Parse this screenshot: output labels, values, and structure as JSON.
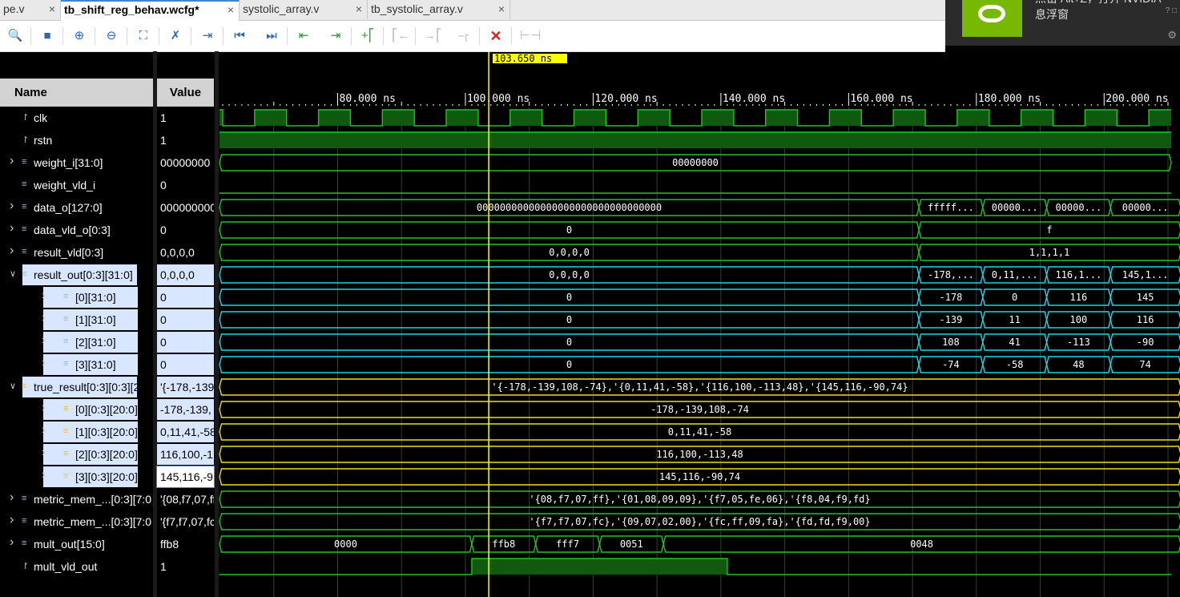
{
  "tabs": [
    {
      "label": "pe.v"
    },
    {
      "label": "tb_shift_reg_behav.wcfg*",
      "active": true
    },
    {
      "label": "systolic_array.v"
    },
    {
      "label": "tb_systolic_array.v"
    }
  ],
  "notification": {
    "line1": "点击 Alt+Z，打开 NVIDIA",
    "line2": "息浮窗"
  },
  "toolbar": {
    "icons": [
      "zoom-search",
      "save",
      "zoom-in",
      "zoom-out",
      "zoom-fit",
      "auto-scroll",
      "goto-cursor",
      "goto-start",
      "goto-end",
      "prev-transition",
      "next-transition",
      "add-marker",
      "prev-marker",
      "next-marker",
      "swap-cursors",
      "delete",
      "snap"
    ]
  },
  "header": {
    "name": "Name",
    "value": "Value"
  },
  "cursor": {
    "label": "103.650 ns",
    "time_ns": 103.65
  },
  "timeline": {
    "start_ns": 61.5,
    "end_ns": 210.5,
    "ticks": [
      "80.000 ns",
      "100.000 ns",
      "120.000 ns",
      "140.000 ns",
      "160.000 ns",
      "180.000 ns",
      "200.000 ns"
    ],
    "tick_ns": [
      80,
      100,
      120,
      140,
      160,
      180,
      200
    ]
  },
  "signals": [
    {
      "name": "clk",
      "value": "1",
      "indent": 0,
      "icon": "bit",
      "expand": false
    },
    {
      "name": "rstn",
      "value": "1",
      "indent": 0,
      "icon": "bit",
      "expand": false
    },
    {
      "name": "weight_i[31:0]",
      "value": "00000000",
      "indent": 0,
      "icon": "bus",
      "expand": "collapsed"
    },
    {
      "name": "weight_vld_i",
      "value": "0",
      "indent": 0,
      "icon": "bus",
      "expand": false
    },
    {
      "name": "data_o[127:0]",
      "value": "000000000",
      "indent": 0,
      "icon": "bus",
      "expand": "collapsed"
    },
    {
      "name": "data_vld_o[0:3]",
      "value": "0",
      "indent": 0,
      "icon": "bus",
      "expand": "collapsed"
    },
    {
      "name": "result_vld[0:3]",
      "value": "0,0,0,0",
      "indent": 0,
      "icon": "bus",
      "expand": "collapsed"
    },
    {
      "name": "result_out[0:3][31:0]",
      "value": "0,0,0,0",
      "indent": 0,
      "icon": "array",
      "expand": "expanded",
      "hl": true
    },
    {
      "name": "[0][31:0]",
      "value": "0",
      "indent": 1,
      "icon": "array",
      "expand": "collapsed",
      "hl": true
    },
    {
      "name": "[1][31:0]",
      "value": "0",
      "indent": 1,
      "icon": "array",
      "expand": "collapsed",
      "hl": true
    },
    {
      "name": "[2][31:0]",
      "value": "0",
      "indent": 1,
      "icon": "array",
      "expand": "collapsed",
      "hl": true
    },
    {
      "name": "[3][31:0]",
      "value": "0",
      "indent": 1,
      "icon": "array",
      "expand": "collapsed",
      "hl": true
    },
    {
      "name": "true_result[0:3][0:3][20:",
      "value": "'{-178,-139",
      "indent": 0,
      "icon": "const",
      "expand": "expanded",
      "hl": true
    },
    {
      "name": "[0][0:3][20:0]",
      "value": "-178,-139,",
      "indent": 1,
      "icon": "const",
      "expand": "collapsed",
      "hl": true
    },
    {
      "name": "[1][0:3][20:0]",
      "value": "0,11,41,-58",
      "indent": 1,
      "icon": "const",
      "expand": "collapsed",
      "hl": true
    },
    {
      "name": "[2][0:3][20:0]",
      "value": "116,100,-1",
      "indent": 1,
      "icon": "const",
      "expand": "collapsed",
      "hl": true
    },
    {
      "name": "[3][0:3][20:0]",
      "value": "145,116,-9",
      "indent": 1,
      "icon": "const",
      "expand": "collapsed",
      "hl": true,
      "boxed": true
    },
    {
      "name": "metric_mem_...[0:3][7:0",
      "value": "'{08,f7,07,ff",
      "indent": 0,
      "icon": "bus",
      "expand": "collapsed"
    },
    {
      "name": "metric_mem_...[0:3][7:0",
      "value": "'{f7,f7,07,fc",
      "indent": 0,
      "icon": "bus",
      "expand": "collapsed"
    },
    {
      "name": "mult_out[15:0]",
      "value": "ffb8",
      "indent": 0,
      "icon": "bus",
      "expand": "collapsed"
    },
    {
      "name": "mult_vld_out",
      "value": "1",
      "indent": 0,
      "icon": "bit",
      "expand": false
    }
  ],
  "waves": [
    {
      "kind": "clock",
      "color": "#22c322",
      "start_ns": 61.5,
      "first_edge_ns": 62,
      "period_ns": 10,
      "start_level": 1
    },
    {
      "kind": "bit",
      "color": "#22c322",
      "segments": [
        [
          61.5,
          210.5,
          1
        ]
      ]
    },
    {
      "kind": "bus",
      "color": "#22c322",
      "segments": [
        [
          61.5,
          210.5,
          "00000000"
        ]
      ]
    },
    {
      "kind": "bit",
      "color": "#22c322",
      "segments": [
        [
          61.5,
          210.5,
          0
        ]
      ]
    },
    {
      "kind": "bus",
      "color": "#22c322",
      "segments": [
        [
          61.5,
          171,
          "00000000000000000000000000000000"
        ],
        [
          171,
          181,
          "fffff..."
        ],
        [
          181,
          191,
          "00000..."
        ],
        [
          191,
          201,
          "00000..."
        ],
        [
          201,
          212,
          "00000..."
        ]
      ]
    },
    {
      "kind": "bus",
      "color": "#22c322",
      "segments": [
        [
          61.5,
          171,
          "0"
        ],
        [
          171,
          212,
          "f"
        ]
      ]
    },
    {
      "kind": "bus",
      "color": "#22c322",
      "segments": [
        [
          61.5,
          171,
          "0,0,0,0"
        ],
        [
          171,
          212,
          "1,1,1,1"
        ]
      ]
    },
    {
      "kind": "bus",
      "color": "#19d9e6",
      "segments": [
        [
          61.5,
          171,
          "0,0,0,0"
        ],
        [
          171,
          181,
          "-178,..."
        ],
        [
          181,
          191,
          "0,11,..."
        ],
        [
          191,
          201,
          "116,1..."
        ],
        [
          201,
          212,
          "145,1..."
        ]
      ]
    },
    {
      "kind": "bus",
      "color": "#19d9e6",
      "segments": [
        [
          61.5,
          171,
          "0"
        ],
        [
          171,
          181,
          "-178"
        ],
        [
          181,
          191,
          "0"
        ],
        [
          191,
          201,
          "116"
        ],
        [
          201,
          212,
          "145"
        ]
      ]
    },
    {
      "kind": "bus",
      "color": "#19d9e6",
      "segments": [
        [
          61.5,
          171,
          "0"
        ],
        [
          171,
          181,
          "-139"
        ],
        [
          181,
          191,
          "11"
        ],
        [
          191,
          201,
          "100"
        ],
        [
          201,
          212,
          "116"
        ]
      ]
    },
    {
      "kind": "bus",
      "color": "#19d9e6",
      "segments": [
        [
          61.5,
          171,
          "0"
        ],
        [
          171,
          181,
          "108"
        ],
        [
          181,
          191,
          "41"
        ],
        [
          191,
          201,
          "-113"
        ],
        [
          201,
          212,
          "-90"
        ]
      ]
    },
    {
      "kind": "bus",
      "color": "#19d9e6",
      "segments": [
        [
          61.5,
          171,
          "0"
        ],
        [
          171,
          181,
          "-74"
        ],
        [
          181,
          191,
          "-58"
        ],
        [
          191,
          201,
          "48"
        ],
        [
          201,
          212,
          "74"
        ]
      ]
    },
    {
      "kind": "bus",
      "color": "#e8e01e",
      "segments": [
        [
          61.5,
          212,
          "'{-178,-139,108,-74},'{0,11,41,-58},'{116,100,-113,48},'{145,116,-90,74}"
        ]
      ]
    },
    {
      "kind": "bus",
      "color": "#e8e01e",
      "segments": [
        [
          61.5,
          212,
          "-178,-139,108,-74"
        ]
      ]
    },
    {
      "kind": "bus",
      "color": "#e8e01e",
      "segments": [
        [
          61.5,
          212,
          "0,11,41,-58"
        ]
      ]
    },
    {
      "kind": "bus",
      "color": "#e8e01e",
      "segments": [
        [
          61.5,
          212,
          "116,100,-113,48"
        ]
      ]
    },
    {
      "kind": "bus",
      "color": "#e8e01e",
      "segments": [
        [
          61.5,
          212,
          "145,116,-90,74"
        ]
      ]
    },
    {
      "kind": "bus",
      "color": "#22c322",
      "segments": [
        [
          61.5,
          212,
          "'{08,f7,07,ff},'{01,08,09,09},'{f7,05,fe,06},'{f8,04,f9,fd}"
        ]
      ]
    },
    {
      "kind": "bus",
      "color": "#22c322",
      "segments": [
        [
          61.5,
          212,
          "'{f7,f7,07,fc},'{09,07,02,00},'{fc,ff,09,fa},'{fd,fd,f9,00}"
        ]
      ]
    },
    {
      "kind": "bus",
      "color": "#22c322",
      "segments": [
        [
          61.5,
          101,
          "0000"
        ],
        [
          101,
          111,
          "ffb8"
        ],
        [
          111,
          121,
          "fff7"
        ],
        [
          121,
          131,
          "0051"
        ],
        [
          131,
          212,
          "0048"
        ]
      ]
    },
    {
      "kind": "bit",
      "color": "#22c322",
      "segments": [
        [
          61.5,
          101,
          0
        ],
        [
          101,
          141,
          1
        ],
        [
          141,
          210.5,
          0
        ]
      ]
    }
  ]
}
